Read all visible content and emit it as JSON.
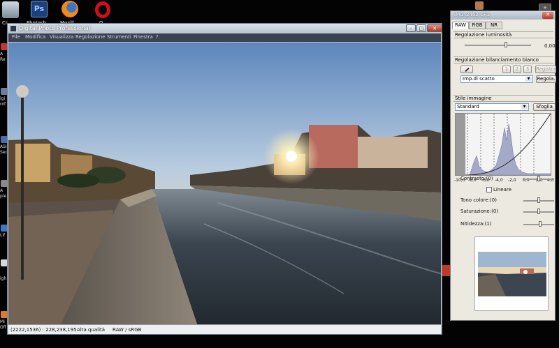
{
  "desktop": {
    "icons": [
      {
        "name": "recycle-bin-icon",
        "label": "Cr"
      },
      {
        "name": "photoshop-icon",
        "label": "Photosh",
        "glyph": "Ps"
      },
      {
        "name": "firefox-icon",
        "label": "Mozill"
      },
      {
        "name": "opera-icon",
        "label": "O"
      }
    ],
    "side_labels": [
      "A",
      "Re",
      "igi",
      "rof",
      "ASI",
      "Sec",
      "A",
      "ple",
      "Lif",
      "igh",
      "Mi",
      "Off"
    ],
    "right_button": "+"
  },
  "main_window": {
    "title": "Digital Photo Professional",
    "title_buttons": {
      "minimize": "–",
      "maximize": "□",
      "close": "✕"
    },
    "menu": [
      "File",
      "Modifica",
      "Visualizza",
      "Regolazione",
      "Strumenti",
      "Finestra",
      "?"
    ],
    "status": {
      "coords": "(2222,1536) : 228,238,195",
      "quality": "Alta qualità",
      "colorspace": "RAW / sRGB"
    }
  },
  "palette": {
    "title": "IMG_2462.CR2",
    "close": "✕",
    "tabs": [
      "RAW",
      "RGB",
      "NR"
    ],
    "brightness": {
      "section": "Regolazione luminosità",
      "value": "0,00"
    },
    "white_balance": {
      "section": "Regolazione bilanciamento bianco",
      "buttons": [
        "1",
        "2",
        "3"
      ],
      "register": "Registra",
      "preset": "Imp.di scatto",
      "adjust": "Regola."
    },
    "picture_style": {
      "section": "Stile immagine",
      "value": "Standard",
      "browse": "Sfoglia"
    },
    "histogram_ticks": [
      "-10,0",
      "-8,0",
      "-6,0",
      "-4,0",
      "-2,0",
      "0,0",
      "2,0",
      "4,0"
    ],
    "contrast": "Contrasto:(0)",
    "linear": "Lineare",
    "color_tone": "Tono colore:(0)",
    "saturation": "Saturazione:(0)",
    "sharpness": "Nitidezza:(1)"
  }
}
